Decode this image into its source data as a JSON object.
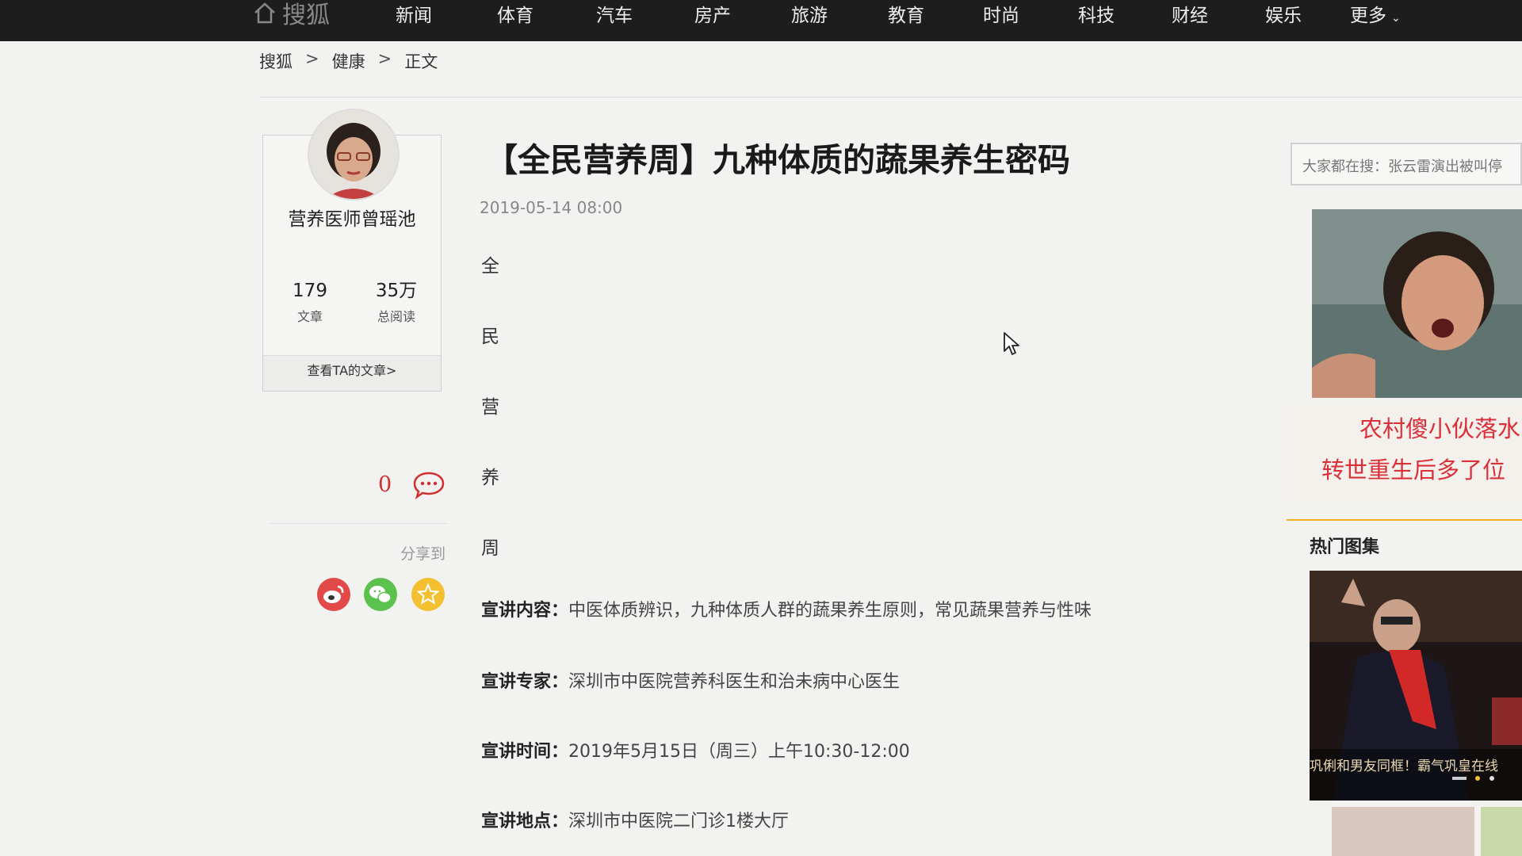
{
  "nav": {
    "logo_text": "搜狐",
    "items": [
      "新闻",
      "体育",
      "汽车",
      "房产",
      "旅游",
      "教育",
      "时尚",
      "科技",
      "财经",
      "娱乐"
    ],
    "more_label": "更多"
  },
  "breadcrumb": [
    "搜狐",
    "健康",
    "正文"
  ],
  "author": {
    "name": "营养医师曾瑶池",
    "articles_count": "179",
    "articles_label": "文章",
    "reads_count": "35万",
    "reads_label": "总阅读",
    "view_link": "查看TA的文章>"
  },
  "social": {
    "comment_count": "0",
    "share_label": "分享到",
    "share_targets": [
      "weibo-icon",
      "wechat-icon",
      "favorite-icon"
    ],
    "colors": {
      "weibo": "#e24a4a",
      "wechat": "#5cc24e",
      "favorite": "#f2c030"
    }
  },
  "article": {
    "title": "【全民营养周】九种体质的蔬果养生密码",
    "date": "2019-05-14 08:00",
    "vertical_chars": [
      "全",
      "民",
      "营",
      "养",
      "周"
    ],
    "paragraphs": [
      {
        "label": "宣讲内容：",
        "text": "中医体质辨识，九种体质人群的蔬果养生原则，常见蔬果营养与性味"
      },
      {
        "label": "宣讲专家：",
        "text": "深圳市中医院营养科医生和治未病中心医生"
      },
      {
        "label": "宣讲时间：",
        "text": "2019年5月15日（周三）上午10:30-12:00"
      },
      {
        "label": "宣讲地点：",
        "text": "深圳市中医院二门诊1楼大厅"
      }
    ]
  },
  "sidebar": {
    "search_text": "大家都在搜：张云雷演出被叫停",
    "ad_line1": "农村傻小伙落水",
    "ad_line2": "转世重生后多了位",
    "section_title": "热门图集",
    "gallery_caption": "巩俐和男友同框！霸气巩皇在线"
  },
  "colors": {
    "nav_bg": "#1d1d1d",
    "accent_red": "#d9303a",
    "divider_yellow": "#f0b020"
  }
}
